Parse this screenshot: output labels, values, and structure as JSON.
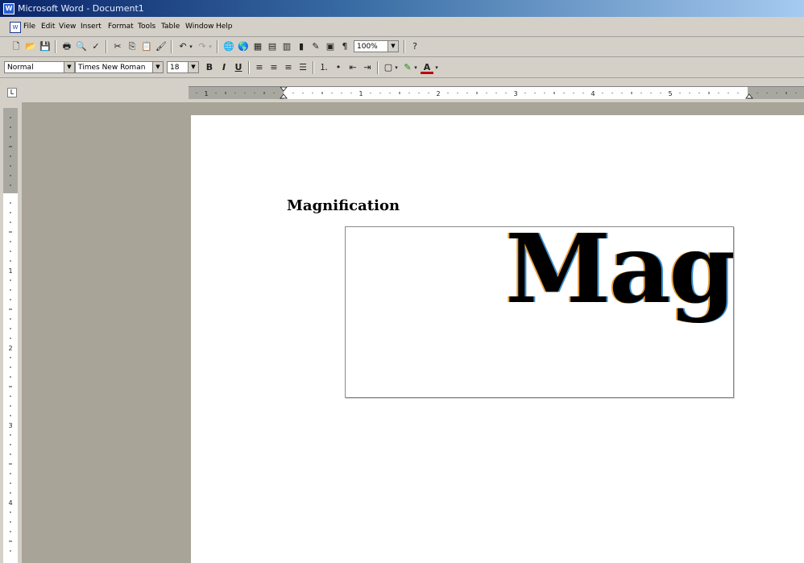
{
  "window": {
    "title": "Microsoft Word - Document1"
  },
  "menu": [
    "File",
    "Edit",
    "View",
    "Insert",
    "Format",
    "Tools",
    "Table",
    "Window",
    "Help"
  ],
  "toolbar": {
    "zoom": "100%"
  },
  "formatting": {
    "style": "Normal",
    "font": "Times New Roman",
    "size": "18"
  },
  "document": {
    "heading": "Magnification",
    "magnified_text": "Mag"
  },
  "ruler": {
    "h_labels": [
      "1",
      "1",
      "2",
      "3",
      "4",
      "5"
    ],
    "v_labels": [
      "1",
      "2",
      "3",
      "4"
    ]
  },
  "colors": {
    "titlebar": "#0a246a",
    "canvas": "#a8a497",
    "chrome": "#d4d0c8"
  }
}
